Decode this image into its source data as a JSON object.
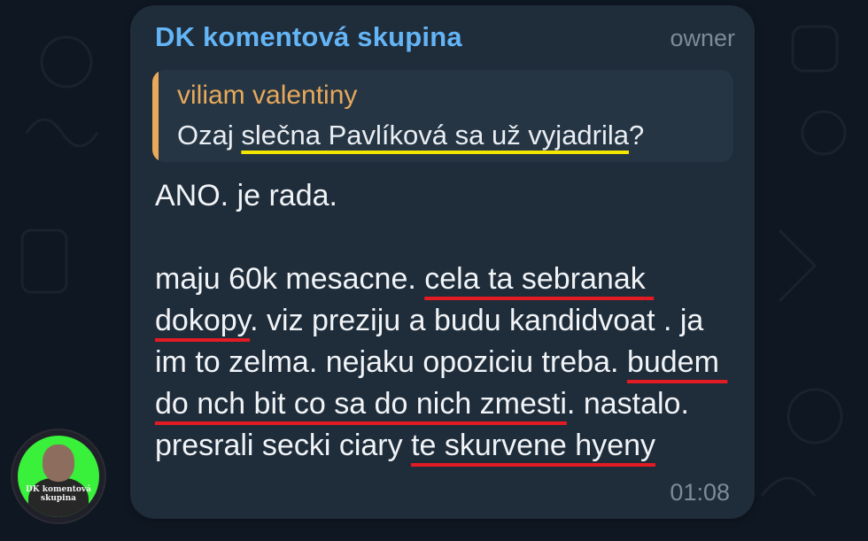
{
  "message": {
    "sender": "DK komentová skupina",
    "role": "owner",
    "time": "01:08",
    "reply": {
      "author": "viliam valentiny",
      "text_before": "Ozaj ",
      "text_highlight": "slečna Pavlíková sa už vyjadrila",
      "text_after": "?"
    },
    "body": {
      "p1": "ANO. je rada.",
      "p2_a": "maju 60k mesacne. ",
      "p2_b": "cela ta sebranak dokopy",
      "p2_c": ". viz preziju a budu kandidvoat . ja im to zelma. nejaku opoziciu treba. ",
      "p2_d": "budem do nch bit co sa do nich zmesti",
      "p2_e": ". nastalo. presrali secki ciary ",
      "p2_f": "te skurvene hyeny"
    }
  },
  "avatar": {
    "caption": "DK komentová skupina",
    "color": "#39f03a"
  },
  "colors": {
    "sender": "#64b5f6",
    "reply_accent": "#e8a95a",
    "bubble": "#1f2c3a",
    "underline_red": "#e31b23",
    "underline_yellow": "#f3e600"
  }
}
